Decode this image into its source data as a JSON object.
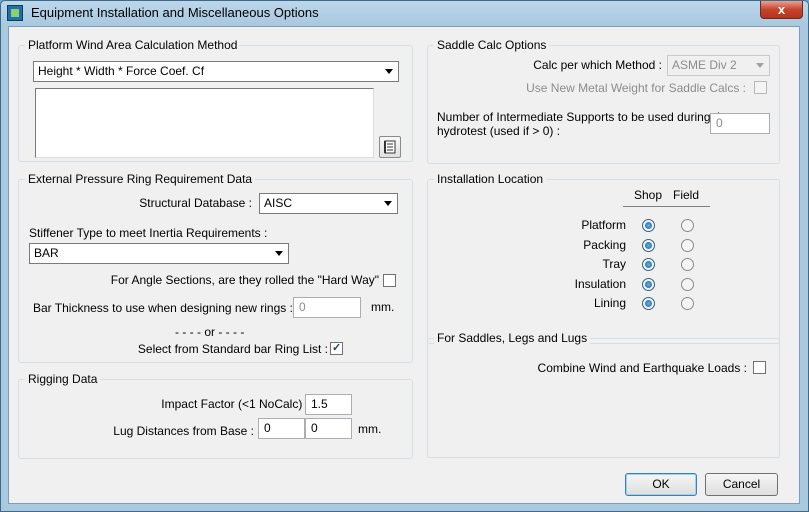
{
  "window": {
    "title": "Equipment Installation and Miscellaneous Options",
    "close_symbol": "x"
  },
  "platform_wind": {
    "legend": "Platform Wind Area Calculation Method",
    "method_value": "Height * Width * Force Coef. Cf",
    "notes_value": "",
    "notes_button_icon": "notepad-icon"
  },
  "saddle_calc": {
    "legend": "Saddle Calc Options",
    "method_label": "Calc per which Method :",
    "method_value": "ASME Div 2",
    "metal_weight_label": "Use New Metal Weight for Saddle Calcs :",
    "metal_weight_checked": false,
    "supports_label_line1": "Number of Intermediate Supports to be used during the",
    "supports_label_line2": "hydrotest (used if > 0) :",
    "supports_value": "0"
  },
  "ext_pressure": {
    "legend": "External Pressure Ring Requirement  Data",
    "db_label": "Structural Database :",
    "db_value": "AISC",
    "stiffener_label": "Stiffener Type to  meet Inertia Requirements :",
    "stiffener_value": "BAR",
    "hard_way_label": "For Angle Sections, are they rolled the \"Hard Way\"",
    "hard_way_checked": false,
    "bar_thickness_label": "Bar Thickness to use when designing new rings :",
    "bar_thickness_value": "0",
    "bar_thickness_unit": "mm.",
    "or_text": "- - - - or - - - -",
    "std_ring_label": "Select from Standard bar Ring List :",
    "std_ring_checked": true
  },
  "install_location": {
    "legend": "Installation Location",
    "col_shop": "Shop",
    "col_field": "Field",
    "rows": [
      {
        "label": "Platform",
        "shop": true
      },
      {
        "label": "Packing",
        "shop": true
      },
      {
        "label": "Tray",
        "shop": true
      },
      {
        "label": "Insulation",
        "shop": true
      },
      {
        "label": "Lining",
        "shop": true
      }
    ]
  },
  "rigging": {
    "legend": "Rigging Data",
    "impact_label": "Impact Factor  (<1 NoCalc) :",
    "impact_value": "1.5",
    "lug_label": "Lug Distances from Base :",
    "lug_value1": "0",
    "lug_value2": "0",
    "lug_unit": "mm."
  },
  "saddles_legs": {
    "legend": "For Saddles, Legs and Lugs",
    "combine_label": "Combine Wind and Earthquake Loads :",
    "combine_checked": false
  },
  "buttons": {
    "ok": "OK",
    "cancel": "Cancel"
  }
}
